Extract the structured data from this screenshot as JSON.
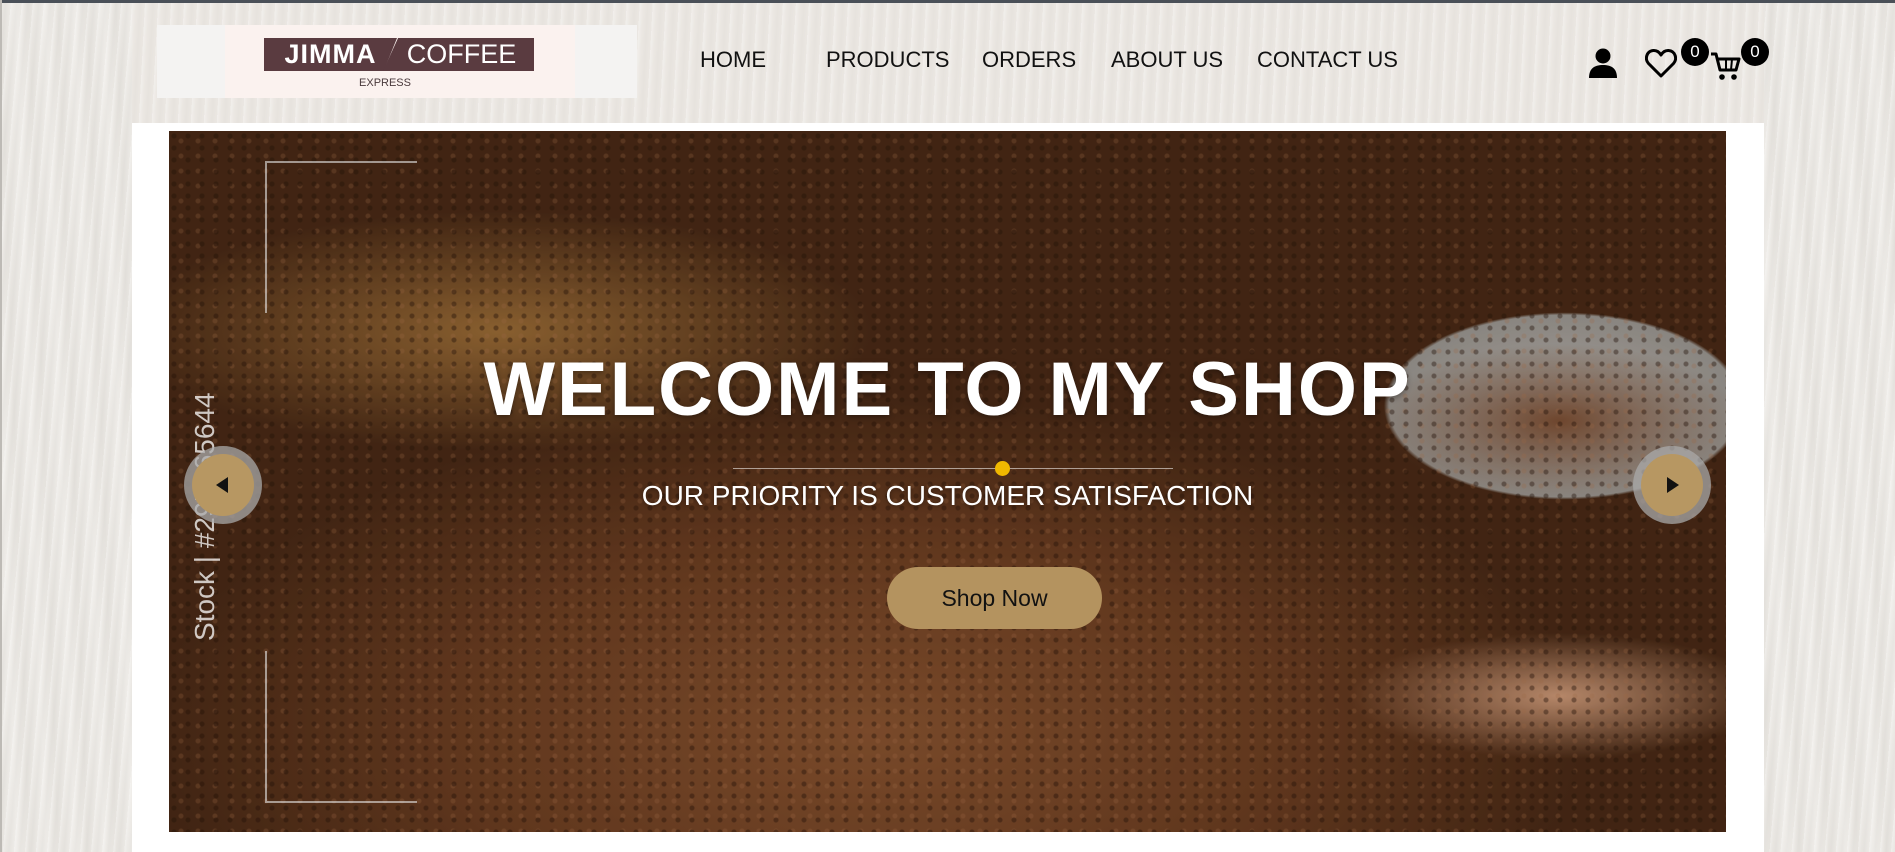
{
  "brand": {
    "logo_word_1": "JIMMA",
    "logo_word_2": "COFFEE",
    "logo_tagline": "EXPRESS"
  },
  "nav": {
    "items": [
      "HOME",
      "PRODUCTS",
      "ORDERS",
      "ABOUT US",
      "CONTACT US"
    ]
  },
  "header_icons": {
    "account": "user-icon",
    "wishlist": "heart-icon",
    "cart": "cart-icon",
    "wishlist_count": "0",
    "cart_count": "0"
  },
  "hero": {
    "title": "WELCOME TO MY SHOP",
    "subtitle": "OUR PRIORITY IS CUSTOMER SATISFACTION",
    "cta_label": "Shop Now",
    "watermark": "Stock | #297665644",
    "prev_icon": "triangle-left-icon",
    "next_icon": "triangle-right-icon"
  },
  "colors": {
    "accent_gold": "#b4935f",
    "divider_dot": "#f0b800",
    "logo_brown": "#5a3b40",
    "badge": "#000000"
  }
}
